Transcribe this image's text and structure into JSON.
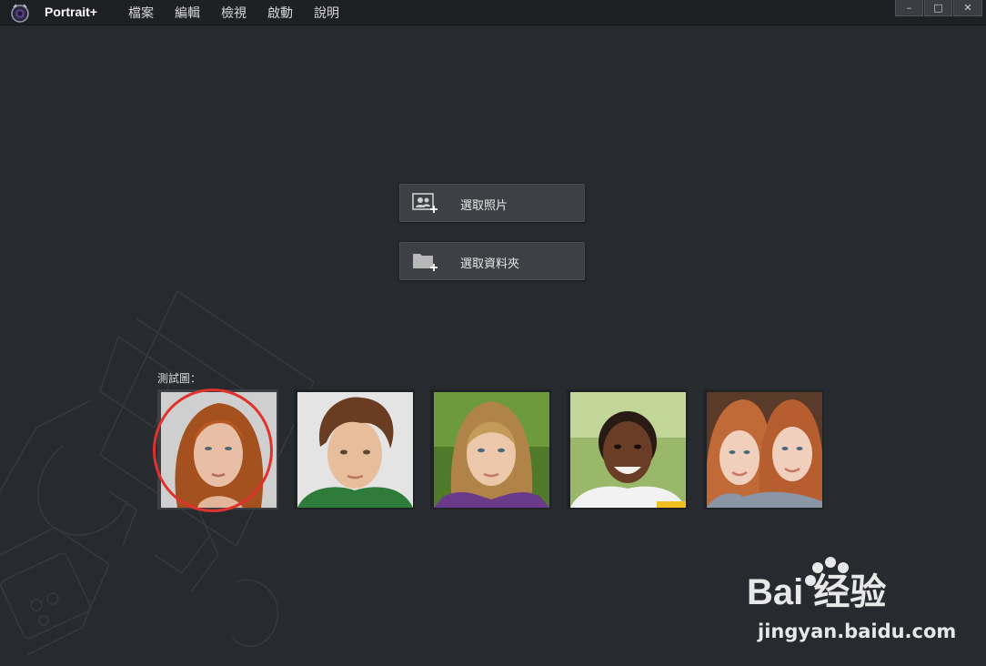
{
  "app": {
    "name": "Portrait+"
  },
  "menu": [
    "檔案",
    "編輯",
    "檢視",
    "啟動",
    "說明"
  ],
  "window_controls": {
    "minimize": "–",
    "maximize": "□",
    "close": "✕"
  },
  "actions": {
    "select_photo": {
      "label": "選取照片",
      "icon": "add-photo-icon"
    },
    "select_folder": {
      "label": "選取資料夾",
      "icon": "add-folder-icon"
    }
  },
  "test_images": {
    "label": "測試圖：",
    "items": [
      {
        "name": "woman-redhead",
        "selected": true
      },
      {
        "name": "boy-brown-hair",
        "selected": false
      },
      {
        "name": "girl-blonde",
        "selected": false
      },
      {
        "name": "girl-smiling",
        "selected": false
      },
      {
        "name": "twin-girls",
        "selected": false
      }
    ]
  },
  "watermark": {
    "brand": "Bai 经验",
    "url": "jingyan.baidu.com"
  },
  "colors": {
    "background": "#272a2e",
    "titlebar": "#1e2023",
    "button": "#3d4045",
    "selection_ring": "#e0322d"
  }
}
